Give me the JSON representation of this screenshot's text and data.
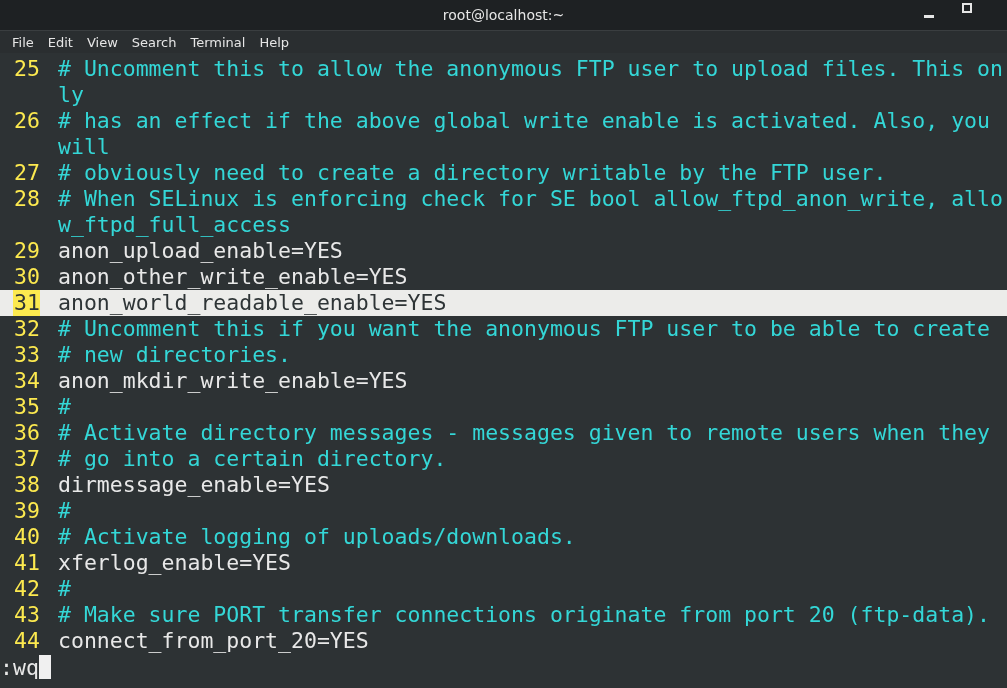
{
  "window": {
    "title": "root@localhost:~"
  },
  "menu": [
    "File",
    "Edit",
    "View",
    "Search",
    "Terminal",
    "Help"
  ],
  "lines": [
    {
      "number": "25",
      "kind": "comment",
      "selected": false,
      "segments": [
        "# Uncomment this to allow the anonymous FTP user to upload files. This on",
        "ly"
      ]
    },
    {
      "number": "26",
      "kind": "comment",
      "selected": false,
      "segments": [
        "# has an effect if the above global write enable is activated. Also, you",
        "will"
      ]
    },
    {
      "number": "27",
      "kind": "comment",
      "selected": false,
      "segments": [
        "# obviously need to create a directory writable by the FTP user."
      ]
    },
    {
      "number": "28",
      "kind": "comment",
      "selected": false,
      "segments": [
        "# When SELinux is enforcing check for SE bool allow_ftpd_anon_write, allo",
        "w_ftpd_full_access"
      ]
    },
    {
      "number": "29",
      "kind": "setting",
      "selected": false,
      "segments": [
        "anon_upload_enable=YES"
      ]
    },
    {
      "number": "30",
      "kind": "setting",
      "selected": false,
      "segments": [
        "anon_other_write_enable=YES"
      ]
    },
    {
      "number": "31",
      "kind": "setting",
      "selected": true,
      "segments": [
        "anon_world_readable_enable=YES"
      ]
    },
    {
      "number": "32",
      "kind": "comment",
      "selected": false,
      "segments": [
        "# Uncomment this if you want the anonymous FTP user to be able to create"
      ]
    },
    {
      "number": "33",
      "kind": "comment",
      "selected": false,
      "segments": [
        "# new directories."
      ]
    },
    {
      "number": "34",
      "kind": "setting",
      "selected": false,
      "segments": [
        "anon_mkdir_write_enable=YES"
      ]
    },
    {
      "number": "35",
      "kind": "comment",
      "selected": false,
      "segments": [
        "#"
      ]
    },
    {
      "number": "36",
      "kind": "comment",
      "selected": false,
      "segments": [
        "# Activate directory messages - messages given to remote users when they"
      ]
    },
    {
      "number": "37",
      "kind": "comment",
      "selected": false,
      "segments": [
        "# go into a certain directory."
      ]
    },
    {
      "number": "38",
      "kind": "setting",
      "selected": false,
      "segments": [
        "dirmessage_enable=YES"
      ]
    },
    {
      "number": "39",
      "kind": "comment",
      "selected": false,
      "segments": [
        "#"
      ]
    },
    {
      "number": "40",
      "kind": "comment",
      "selected": false,
      "segments": [
        "# Activate logging of uploads/downloads."
      ]
    },
    {
      "number": "41",
      "kind": "setting",
      "selected": false,
      "segments": [
        "xferlog_enable=YES"
      ]
    },
    {
      "number": "42",
      "kind": "comment",
      "selected": false,
      "segments": [
        "#"
      ]
    },
    {
      "number": "43",
      "kind": "comment",
      "selected": false,
      "segments": [
        "# Make sure PORT transfer connections originate from port 20 (ftp-data)."
      ]
    },
    {
      "number": "44",
      "kind": "setting",
      "selected": false,
      "segments": [
        "connect_from_port_20=YES"
      ]
    }
  ],
  "command_line": {
    "text": ":wq"
  }
}
